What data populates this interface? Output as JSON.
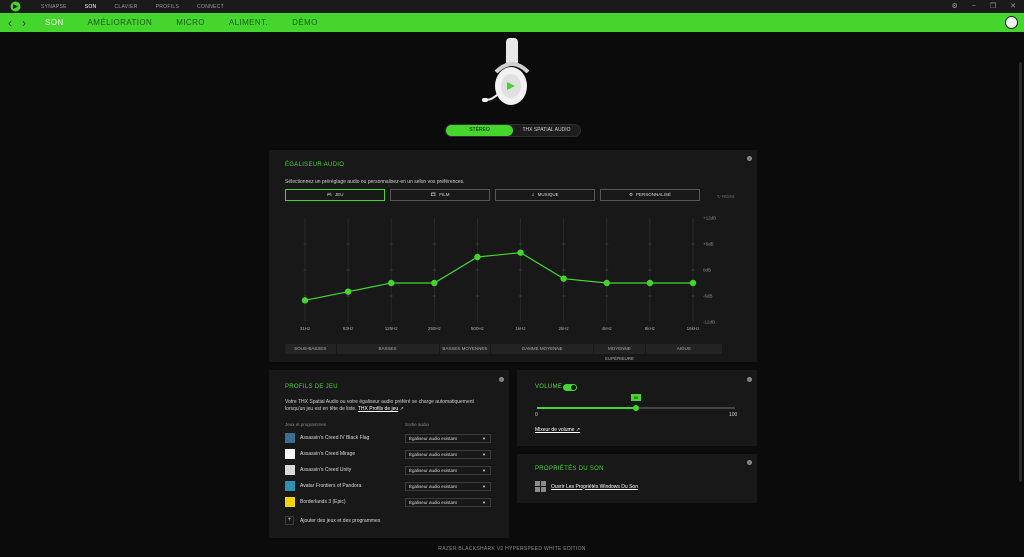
{
  "topnav": {
    "items": [
      "SYNAPSE",
      "SON",
      "CLAVIER",
      "PROFILS",
      "CONNECT"
    ],
    "active_index": 1
  },
  "window_controls": [
    "gear",
    "minimize",
    "maximize",
    "close"
  ],
  "subnav": {
    "items": [
      "SON",
      "AMÉLIORATION",
      "MICRO",
      "ALIMENT.",
      "DÉMO"
    ],
    "active_index": 0
  },
  "mode": {
    "options": [
      "STÉRÉO",
      "THX SPATIAL AUDIO"
    ],
    "active_index": 0
  },
  "equalizer": {
    "title": "ÉGALISEUR AUDIO",
    "description": "Sélectionnez un préréglage audio ou personnalisez-en un selon vos préférences.",
    "presets": [
      {
        "label": "JEU",
        "icon": "gamepad-icon",
        "active": true
      },
      {
        "label": "FILM",
        "icon": "film-icon",
        "active": false
      },
      {
        "label": "MUSIQUE",
        "icon": "music-note-icon",
        "active": false
      },
      {
        "label": "PERSONNALISÉ",
        "icon": "sliders-icon",
        "active": false
      }
    ],
    "reset_label": "RÉINI.",
    "db_labels": [
      "+12dB",
      "+6dB",
      "0dB",
      "-6dB",
      "-12dB"
    ]
  },
  "chart_data": {
    "type": "line",
    "x": [
      "31Hz",
      "63Hz",
      "125Hz",
      "250Hz",
      "500Hz",
      "1kHz",
      "2kHz",
      "4kHz",
      "8kHz",
      "16kHz"
    ],
    "series": [
      {
        "values": [
          -7,
          -5,
          -3,
          -3,
          3,
          4,
          -2,
          -3,
          -3,
          -3
        ]
      }
    ],
    "ylim": [
      -12,
      12
    ],
    "color": "#44d62c"
  },
  "freq_bands": [
    {
      "label": "SOUS-BASSES",
      "span": 1
    },
    {
      "label": "BASSES",
      "span": 2
    },
    {
      "label": "BASSES MOYENNES",
      "span": 1
    },
    {
      "label": "GAMME MOYENNE",
      "span": 2
    },
    {
      "label": "MOYENNE SUPÉRIEURE",
      "span": 1
    },
    {
      "label": "AIGUS",
      "span": 1.5
    }
  ],
  "profiles": {
    "title": "PROFILS DE JEU",
    "description": "Votre THX Spatial Audio ou votre égaliseur audio préféré se charge automatiquement lorsqu'un jeu est en tête de liste.",
    "link": "THX Profils de jeu",
    "col_games": "Jeux et programmes",
    "col_output": "Sortie audio",
    "games": [
      {
        "name": "Assassin's Creed IV Black Flag",
        "output": "Égaliseur audio existant",
        "color": "#3a6f8f"
      },
      {
        "name": "Assassin's Creed Mirage",
        "output": "Égaliseur audio existant",
        "color": "#ffffff"
      },
      {
        "name": "Assassin's Creed Unity",
        "output": "Égaliseur audio existant",
        "color": "#d8d8d8"
      },
      {
        "name": "Avatar Frontiers of Pandora",
        "output": "Égaliseur audio existant",
        "color": "#2f8fb0"
      },
      {
        "name": "Borderlands 3 (Epic)",
        "output": "Égaliseur audio existant",
        "color": "#f2d400"
      }
    ],
    "add_label": "Ajouter des jeux et des programmes"
  },
  "volume": {
    "title": "VOLUME",
    "enabled": true,
    "value": 50,
    "min": "0",
    "max": "100",
    "mixer_label": "Mixeur de volume"
  },
  "sound_props": {
    "title": "PROPRIÉTÉS DU SON",
    "link": "Ouvrir Les Propriétés Windows Du Son"
  },
  "footer": "RAZER BLACKSHARK V2 HYPERSPEED WHITE EDITION"
}
